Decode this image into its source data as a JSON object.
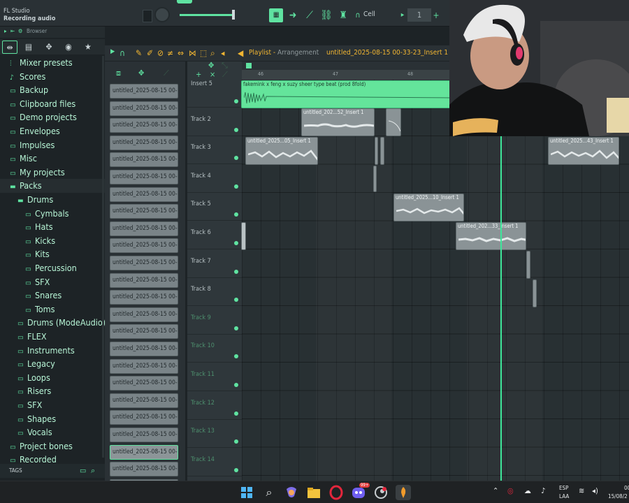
{
  "app": {
    "title": "FL Studio",
    "subtitle": "Recording audio",
    "accent": "#5fe3a1",
    "playlist_color": "#f2b632"
  },
  "toolbar": {
    "snap_label": "Cell",
    "pattern_number": "1"
  },
  "browser": {
    "header_label": "Browser",
    "tags_label": "TAGS",
    "items": [
      {
        "label": "Mixer presets",
        "icon": "mixer-icon",
        "level": 0
      },
      {
        "label": "Scores",
        "icon": "music-note-icon",
        "level": 0
      },
      {
        "label": "Backup",
        "icon": "folder-icon",
        "level": 0
      },
      {
        "label": "Clipboard files",
        "icon": "folder-icon",
        "level": 0
      },
      {
        "label": "Demo projects",
        "icon": "folder-icon",
        "level": 0
      },
      {
        "label": "Envelopes",
        "icon": "folder-icon",
        "level": 0
      },
      {
        "label": "Impulses",
        "icon": "folder-icon",
        "level": 0
      },
      {
        "label": "Misc",
        "icon": "folder-icon",
        "level": 0
      },
      {
        "label": "My projects",
        "icon": "folder-icon",
        "level": 0
      },
      {
        "label": "Packs",
        "icon": "open-folder-icon",
        "level": 0
      },
      {
        "label": "Drums",
        "icon": "open-folder-icon",
        "level": 1
      },
      {
        "label": "Cymbals",
        "icon": "folder-icon",
        "level": 2
      },
      {
        "label": "Hats",
        "icon": "folder-icon",
        "level": 2
      },
      {
        "label": "Kicks",
        "icon": "folder-icon",
        "level": 2
      },
      {
        "label": "Kits",
        "icon": "folder-icon",
        "level": 2
      },
      {
        "label": "Percussion",
        "icon": "folder-icon",
        "level": 2
      },
      {
        "label": "SFX",
        "icon": "folder-icon",
        "level": 2
      },
      {
        "label": "Snares",
        "icon": "folder-icon",
        "level": 2
      },
      {
        "label": "Toms",
        "icon": "folder-icon",
        "level": 2
      },
      {
        "label": "Drums (ModeAudio)",
        "icon": "folder-icon",
        "level": 1
      },
      {
        "label": "FLEX",
        "icon": "folder-icon",
        "level": 1
      },
      {
        "label": "Instruments",
        "icon": "folder-icon",
        "level": 1
      },
      {
        "label": "Legacy",
        "icon": "folder-icon",
        "level": 1
      },
      {
        "label": "Loops",
        "icon": "folder-icon",
        "level": 1
      },
      {
        "label": "Risers",
        "icon": "folder-icon",
        "level": 1
      },
      {
        "label": "SFX",
        "icon": "folder-icon",
        "level": 1
      },
      {
        "label": "Shapes",
        "icon": "folder-icon",
        "level": 1
      },
      {
        "label": "Vocals",
        "icon": "folder-icon",
        "level": 1
      },
      {
        "label": "Project bones",
        "icon": "folder-icon",
        "level": 0
      },
      {
        "label": "Recorded",
        "icon": "folder-icon",
        "level": 0
      }
    ]
  },
  "playlist": {
    "title": "Playlist",
    "subtitle": "Arrangement",
    "filename": "untitled_2025-08-15 00-33-23_Insert 1",
    "timeline_ticks": [
      "46",
      "47",
      "48"
    ],
    "clip_list": [
      "untitled_2025-08-15 00-...",
      "untitled_2025-08-15 00-...",
      "untitled_2025-08-15 00-...",
      "untitled_2025-08-15 00-...",
      "untitled_2025-08-15 00-...",
      "untitled_2025-08-15 00-...",
      "untitled_2025-08-15 00-...",
      "untitled_2025-08-15 00-...",
      "untitled_2025-08-15 00-...",
      "untitled_2025-08-15 00-...",
      "untitled_2025-08-15 00-...",
      "untitled_2025-08-15 00-...",
      "untitled_2025-08-15 00-...",
      "untitled_2025-08-15 00-...",
      "untitled_2025-08-15 00-...",
      "untitled_2025-08-15 00-...",
      "untitled_2025-08-15 00-...",
      "untitled_2025-08-15 00-...",
      "untitled_2025-08-15 00-...",
      "untitled_2025-08-15 00-...",
      "untitled_2025-08-15 00-...",
      "untitled_2025-08-15 00-...",
      "untitled_2025-08-15 00-...",
      "untitled_2025-08-15 00-..."
    ],
    "tracks": [
      {
        "name": "Insert 5",
        "active": true
      },
      {
        "name": "Track 2",
        "active": true
      },
      {
        "name": "Track 3",
        "active": true
      },
      {
        "name": "Track 4",
        "active": true
      },
      {
        "name": "Track 5",
        "active": true
      },
      {
        "name": "Track 6",
        "active": true
      },
      {
        "name": "Track 7",
        "active": true
      },
      {
        "name": "Track 8",
        "active": true
      },
      {
        "name": "Track 9",
        "active": false
      },
      {
        "name": "Track 10",
        "active": false
      },
      {
        "name": "Track 11",
        "active": false
      },
      {
        "name": "Track 12",
        "active": false
      },
      {
        "name": "Track 13",
        "active": false
      },
      {
        "name": "Track 14",
        "active": false
      }
    ],
    "clips": {
      "beat": "fakemink x feng x suzy sheer type beat (prod 8fold)",
      "c_t2a": "untitled_202...52_Insert 1",
      "c_t3a": "untitled_2025...05_Insert 1",
      "c_t3b": "untitled_2025...43_Insert 1",
      "c_t5": "untitled_2025...10_Insert 1",
      "c_t6": "untitled_202...33_Insert 1"
    }
  },
  "taskbar": {
    "lang": "ESP",
    "lang_sub": "LAA",
    "time": "00",
    "date": "15/08/2",
    "discord_badge": "99+"
  }
}
